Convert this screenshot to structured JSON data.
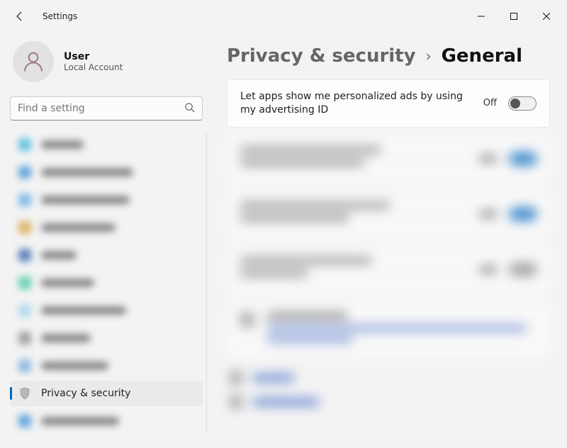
{
  "window": {
    "title": "Settings"
  },
  "user": {
    "name": "User",
    "account_type": "Local Account"
  },
  "search": {
    "placeholder": "Find a setting"
  },
  "nav": {
    "active": {
      "label": "Privacy & security"
    }
  },
  "breadcrumb": {
    "parent": "Privacy & security",
    "current": "General"
  },
  "setting": {
    "description": "Let apps show me personalized ads by using my advertising ID",
    "state_label": "Off",
    "value": false
  }
}
